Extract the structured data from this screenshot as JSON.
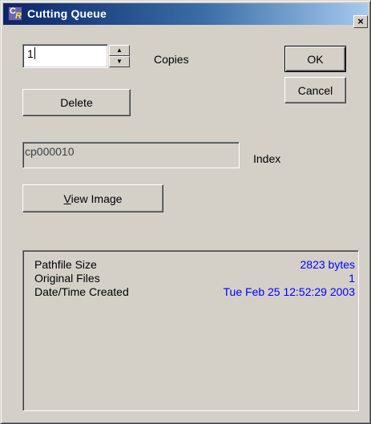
{
  "window": {
    "title": "Cutting Queue",
    "close_glyph": "×",
    "app_icon": "cr-app-icon"
  },
  "copies": {
    "value": "1",
    "label": "Copies",
    "spin_up": "▲",
    "spin_down": "▼"
  },
  "buttons": {
    "ok": "OK",
    "cancel": "Cancel",
    "delete": "Delete",
    "view_image_mnemonic": "V",
    "view_image_rest": "iew Image"
  },
  "index": {
    "value": "cp000010",
    "label": "Index"
  },
  "info": {
    "rows": [
      {
        "key": "Pathfile Size",
        "value": "2823 bytes"
      },
      {
        "key": "Original Files",
        "value": "1"
      },
      {
        "key": "Date/Time Created",
        "value": "Tue Feb 25 12:52:29 2003"
      }
    ]
  },
  "colors": {
    "face": "#d4d0c8",
    "title_start": "#0a246a",
    "title_end": "#a6caf0",
    "info_value": "#0000ff"
  }
}
